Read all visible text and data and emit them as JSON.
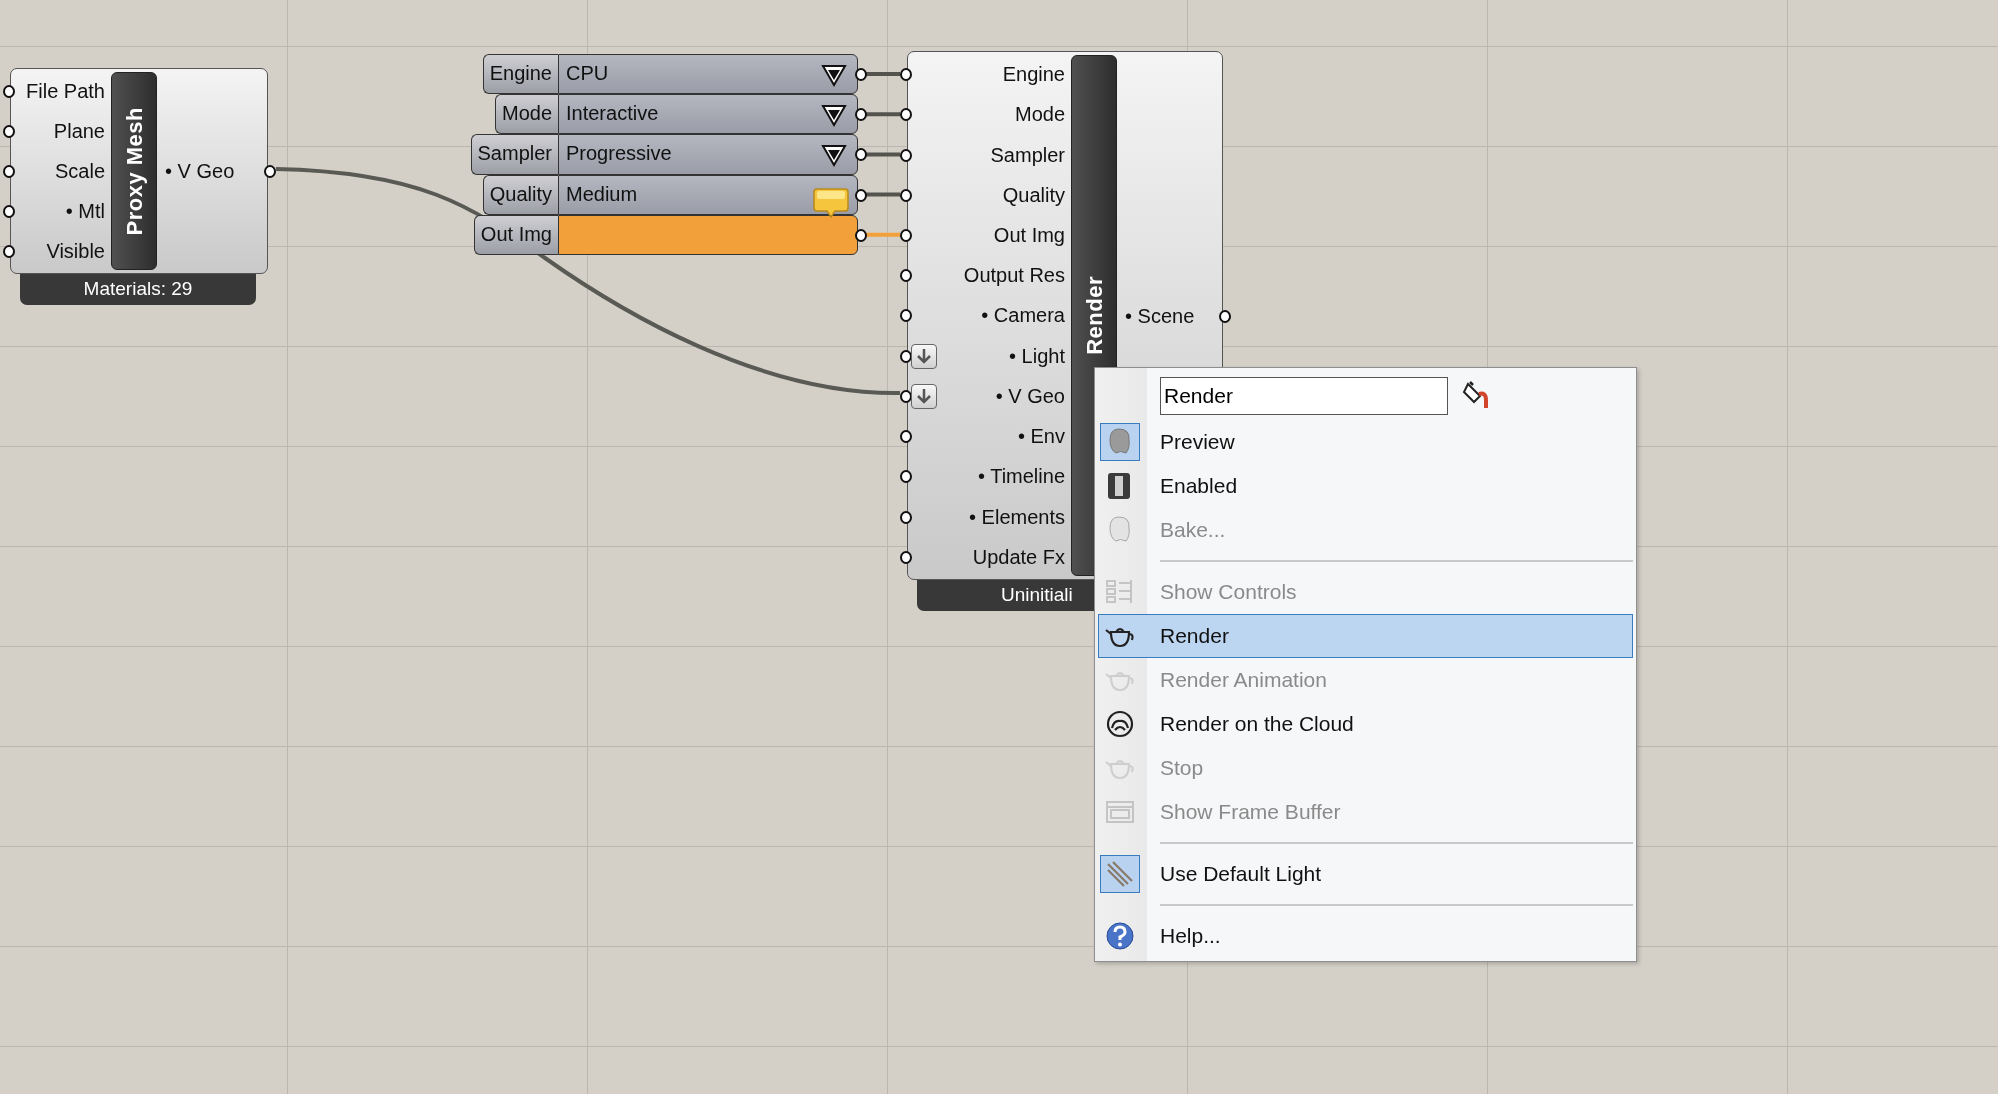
{
  "canvas": {
    "nodes": [
      {
        "kind": "component",
        "title": "Proxy Mesh",
        "footer": "Materials: 29",
        "inputs": [
          {
            "label": "File Path",
            "flattened": false
          },
          {
            "label": "Plane",
            "flattened": false
          },
          {
            "label": "Scale",
            "flattened": false
          },
          {
            "label": "• Mtl",
            "flattened": false
          },
          {
            "label": "Visible",
            "flattened": false
          }
        ],
        "outputs": [
          {
            "label": "• V Geo"
          }
        ]
      },
      {
        "kind": "component",
        "title": "Render",
        "footer": "Uninitiali",
        "inputs": [
          {
            "label": "Engine",
            "flattened": false
          },
          {
            "label": "Mode",
            "flattened": false
          },
          {
            "label": "Sampler",
            "flattened": false
          },
          {
            "label": "Quality",
            "flattened": false
          },
          {
            "label": "Out Img",
            "flattened": false
          },
          {
            "label": "Output Res",
            "flattened": false
          },
          {
            "label": "• Camera",
            "flattened": false
          },
          {
            "label": "• Light",
            "flattened": true
          },
          {
            "label": "• V Geo",
            "flattened": true
          },
          {
            "label": "• Env",
            "flattened": false
          },
          {
            "label": "• Timeline",
            "flattened": false
          },
          {
            "label": "• Elements",
            "flattened": false
          },
          {
            "label": "Update Fx",
            "flattened": false
          }
        ],
        "outputs": [
          {
            "label": "• Scene"
          }
        ]
      }
    ],
    "value_lists": [
      {
        "kind": "dropdown",
        "label": "Engine",
        "value": "CPU",
        "warning": false
      },
      {
        "kind": "dropdown",
        "label": "Mode",
        "value": "Interactive",
        "warning": false
      },
      {
        "kind": "dropdown",
        "label": "Sampler",
        "value": "Progressive",
        "warning": false
      },
      {
        "kind": "dropdown",
        "label": "Quality",
        "value": "Medium",
        "warning": true
      },
      {
        "kind": "swatch",
        "label": "Out Img",
        "color": "#f2a03a",
        "warning": false
      }
    ]
  },
  "context_menu": {
    "name_field": {
      "value": "Render"
    },
    "items": [
      {
        "kind": "item",
        "label": "Preview",
        "checked": true,
        "disabled": false,
        "selected": false
      },
      {
        "kind": "item",
        "label": "Enabled",
        "checked": false,
        "disabled": false,
        "selected": false
      },
      {
        "kind": "item",
        "label": "Bake...",
        "checked": false,
        "disabled": true,
        "selected": false
      },
      {
        "kind": "separator"
      },
      {
        "kind": "item",
        "label": "Show Controls",
        "checked": false,
        "disabled": true,
        "selected": false
      },
      {
        "kind": "item",
        "label": "Render",
        "checked": false,
        "disabled": false,
        "selected": true
      },
      {
        "kind": "item",
        "label": "Render Animation",
        "checked": false,
        "disabled": true,
        "selected": false
      },
      {
        "kind": "item",
        "label": "Render on the Cloud",
        "checked": false,
        "disabled": false,
        "selected": false
      },
      {
        "kind": "item",
        "label": "Stop",
        "checked": false,
        "disabled": true,
        "selected": false
      },
      {
        "kind": "item",
        "label": "Show Frame Buffer",
        "checked": false,
        "disabled": true,
        "selected": false
      },
      {
        "kind": "separator"
      },
      {
        "kind": "item",
        "label": "Use Default Light",
        "checked": true,
        "disabled": false,
        "selected": false
      },
      {
        "kind": "separator"
      },
      {
        "kind": "item",
        "label": "Help...",
        "checked": false,
        "disabled": false,
        "selected": false
      }
    ]
  }
}
